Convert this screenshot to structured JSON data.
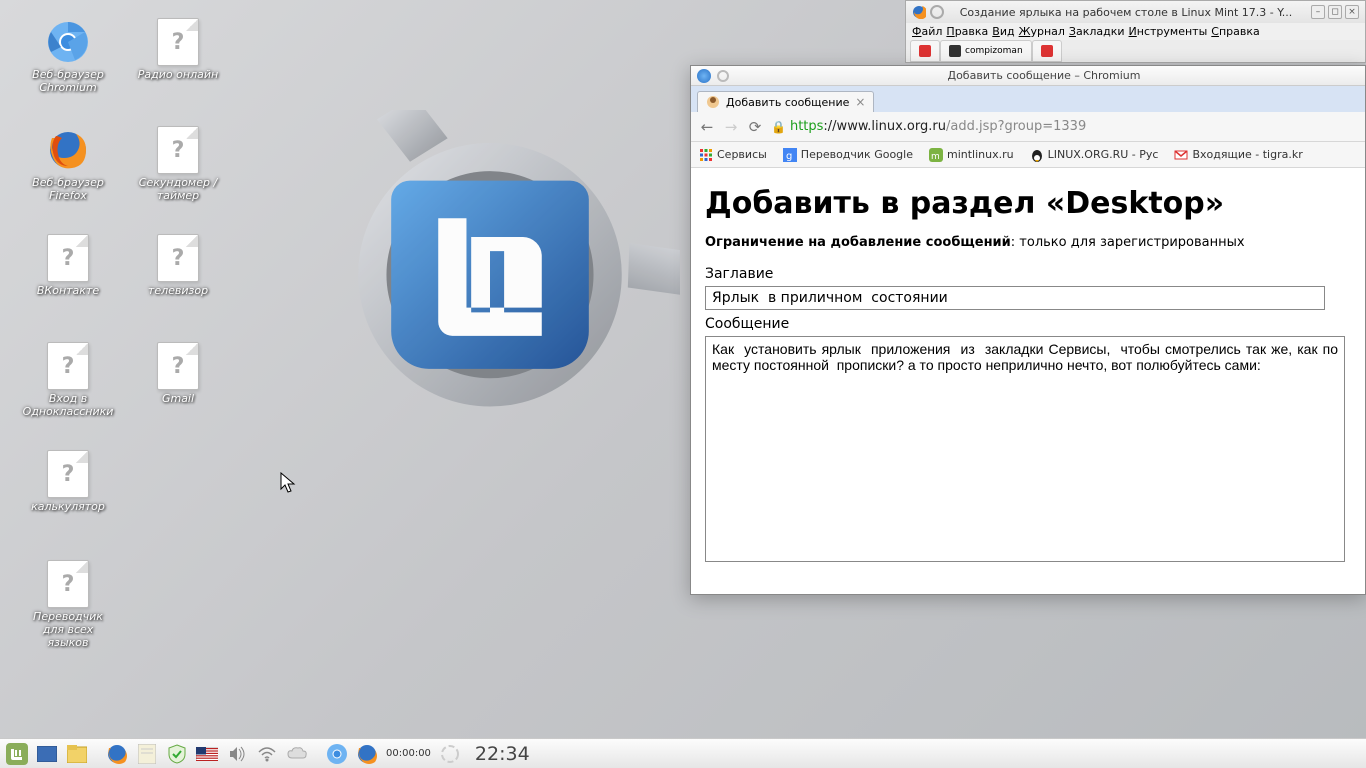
{
  "desktop_icons": {
    "chromium": "Веб-браузер Chromium",
    "radio": "Радио онлайн",
    "firefox": "Веб-браузер Firefox",
    "timer": "Секундомер / таймер",
    "vk": "ВКонтакте",
    "tv": "телевизор",
    "ok": "Вход в Одноклассники",
    "gmail": "Gmail",
    "calc": "калькулятор",
    "trans": "Переводчик для всех языков"
  },
  "firefox": {
    "title": "Создание ярлыка на рабочем столе в Linux Mint 17.3 - Y...",
    "menu": {
      "file": "Файл",
      "edit": "Правка",
      "view": "Вид",
      "journal": "Журнал",
      "bookmarks": "Закладки",
      "tools": "Инструменты",
      "help": "Справка"
    }
  },
  "chromium": {
    "window_title": "Добавить сообщение – Chromium",
    "tab_title": "Добавить сообщение",
    "url": {
      "scheme": "https",
      "host": "://www.linux.org.ru",
      "path": "/add.jsp?group=1339"
    },
    "bookmarks": {
      "apps": "Сервисы",
      "trans": "Переводчик Google",
      "mint": "mintlinux.ru",
      "lor": "LINUX.ORG.RU - Рус",
      "inbox": "Входящие - tigra.kr"
    },
    "page": {
      "h1": "Добавить в раздел «Desktop»",
      "restrict_label": "Ограничение на добавление сообщений",
      "restrict_text": ": только для зарегистрированных",
      "title_label": "Заглавие",
      "title_value": "Ярлык  в приличном  состоянии",
      "msg_label": "Сообщение",
      "msg_value": "Как  установить ярлык  приложения  из  закладки Сервисы,  чтобы смотрелись так же, как по месту постоянной  прописки? а то просто неприлично нечто, вот полюбуйтесь сами:"
    }
  },
  "taskbar": {
    "elapsed": "00:00:00",
    "clock": "22:34"
  }
}
